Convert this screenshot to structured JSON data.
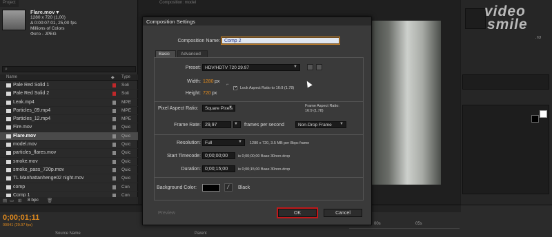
{
  "project": {
    "tab_label": "Project",
    "file": {
      "name": "Flare.mov ▾",
      "size": "1280 x 720 (1,00)",
      "duration": "Δ 0:00:07:01, 25,00 fps",
      "colors": "Millions of Colors",
      "codec": "Фото - JPEG"
    },
    "columns": {
      "name": "Name",
      "type": "Type"
    },
    "items": [
      {
        "name": "Pale Red Solid 1",
        "type": "Soli",
        "label_color": "#c0282a",
        "selected": false
      },
      {
        "name": "Pale Red Solid 2",
        "type": "Soli",
        "label_color": "#c0282a",
        "selected": false
      },
      {
        "name": "Leak.mp4",
        "type": "MPE",
        "label_color": "#8a8a8a",
        "selected": false
      },
      {
        "name": "Particles_09.mp4",
        "type": "MPE",
        "label_color": "#8a8a8a",
        "selected": false
      },
      {
        "name": "Particles_12.mp4",
        "type": "MPE",
        "label_color": "#8a8a8a",
        "selected": false
      },
      {
        "name": "Fire.mov",
        "type": "Quic",
        "label_color": "#8a8a8a",
        "selected": false
      },
      {
        "name": "Flare.mov",
        "type": "Quic",
        "label_color": "#8a8a8a",
        "selected": true
      },
      {
        "name": "model.mov",
        "type": "Quic",
        "label_color": "#8a8a8a",
        "selected": false
      },
      {
        "name": "particles_flares.mov",
        "type": "Quic",
        "label_color": "#8a8a8a",
        "selected": false
      },
      {
        "name": "smoke.mov",
        "type": "Quic",
        "label_color": "#8a8a8a",
        "selected": false
      },
      {
        "name": "smoke_pass_720p.mov",
        "type": "Quic",
        "label_color": "#8a8a8a",
        "selected": false
      },
      {
        "name": "TL Manhattanhenge02 night.mov",
        "type": "Quic",
        "label_color": "#8a8a8a",
        "selected": false
      },
      {
        "name": "comp",
        "type": "Con",
        "label_color": "#8a8a8a",
        "selected": false
      },
      {
        "name": "Comp 1",
        "type": "Con",
        "label_color": "#8a8a8a",
        "selected": false
      }
    ],
    "footer_bpc": "8 bpc"
  },
  "viewer": {
    "tab_label": "Composition: model"
  },
  "logo": {
    "line1": "video",
    "line2": "smile",
    "domain": ".ru"
  },
  "timeline": {
    "timecode": "0;00;01;11",
    "fps": "00041 (29.97 fps)",
    "source_name_header": "Source Name",
    "parent_header": "Parent",
    "ruler": [
      "00s",
      "05s"
    ]
  },
  "dialog": {
    "title": "Composition Settings",
    "comp_name_label": "Composition Name:",
    "comp_name_value": "Comp 2",
    "tab_basic": "Basic",
    "tab_advanced": "Advanced",
    "preset_label": "Preset:",
    "preset_value": "HDV/HDTV 720 29.97",
    "width_label": "Width:",
    "width_value": "1280",
    "height_label": "Height:",
    "height_value": "720",
    "px": "px",
    "lock_aspect": "Lock Aspect Ratio to 16:9 (1.78)",
    "par_label": "Pixel Aspect Ratio:",
    "par_value": "Square Pixels",
    "frame_aspect_label": "Frame Aspect Ratio:",
    "frame_aspect_value": "16:9 (1.78)",
    "frame_rate_label": "Frame Rate:",
    "frame_rate_value": "29,97",
    "frames_per_second": "frames per second",
    "drop_frame_value": "Non-Drop Frame",
    "resolution_label": "Resolution:",
    "resolution_value": "Full",
    "resolution_info": "1280 x 720, 3.5 MB per 8bpc frame",
    "start_tc_label": "Start Timecode:",
    "start_tc_value": "0;00;00;00",
    "start_tc_info": "is 0;00;00;00  Base 30non-drop",
    "duration_label": "Duration:",
    "duration_value": "0;00;15;00",
    "duration_info": "is 0;00;15;00  Base 30non-drop",
    "bg_color_label": "Background Color:",
    "bg_color_name": "Black",
    "preview_label": "Preview",
    "ok_label": "OK",
    "cancel_label": "Cancel"
  }
}
